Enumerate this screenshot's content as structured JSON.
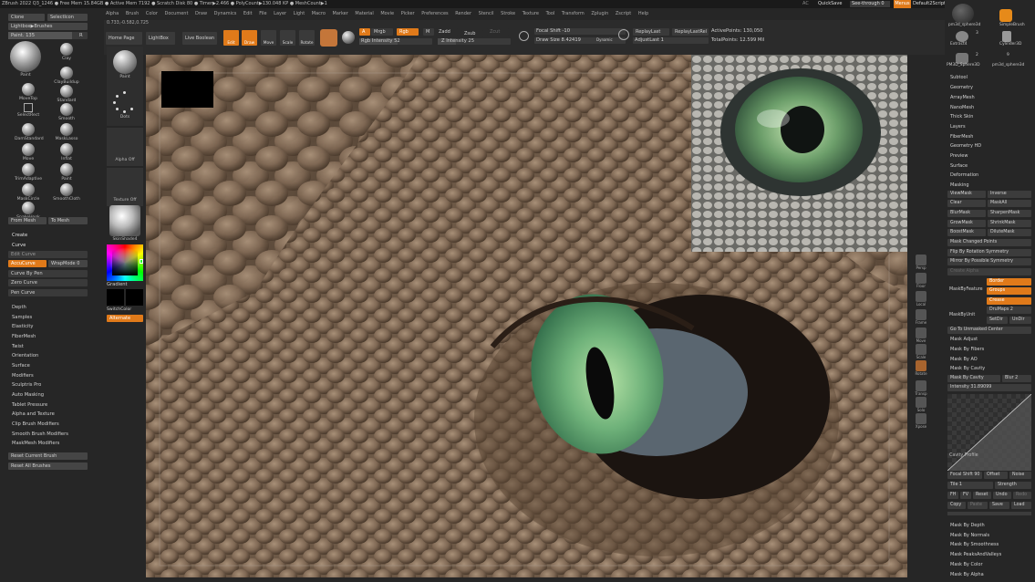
{
  "titlebar": {
    "text": "ZBrush 2022   Q3_1246   ● Free Mem 15.84GB ● Active Mem 7192 ● Scratch Disk 80 ● Timer▶2.466 ● PolyCount▶130.048 KP ● MeshCount▶1",
    "right_items": [
      "AC",
      "QuickSave",
      "See-through  0",
      "Menus",
      "Default2Script"
    ]
  },
  "menubar": {
    "items": [
      "Alpha",
      "Brush",
      "Color",
      "Document",
      "Draw",
      "Dynamics",
      "Edit",
      "File",
      "Layer",
      "Light",
      "Macro",
      "Marker",
      "Material",
      "Movie",
      "Picker",
      "Preferences",
      "Render",
      "Stencil",
      "Stroke",
      "Texture",
      "Tool",
      "Transform",
      "Zplugin",
      "Zscript",
      "Help"
    ]
  },
  "left": {
    "clone": "Clone",
    "select_icon": "SelectIcon",
    "lightbox_brushes": "Lightbox▶Brushes",
    "paint_value": "Paint. 135",
    "paint_suffix": "R",
    "brushes": [
      "Paint",
      "Clay",
      "ClayBuildup",
      "MoveTop",
      "Standard",
      "SelectRect",
      "Smooth",
      "DamStandard",
      "MaskLasso",
      "Move",
      "Inflat",
      "TrimAdaptive",
      "Paint",
      "MaskCircle",
      "SmoothCloth",
      "SnakeHook"
    ],
    "from_mesh": "From Mesh",
    "to_mesh": "To Mesh",
    "create": "Create",
    "curve": "Curve",
    "edit_curve": "Edit Curve",
    "accucurve": "AccuCurve",
    "wrapmode": "WrapMode 0",
    "curve_by_pen": "Curve By Pen",
    "zero_curve": "Zero Curve",
    "pen_curve": "Pen Curve",
    "sections": [
      "Depth",
      "Samples",
      "Elasticity",
      "FiberMesh",
      "Twist",
      "Orientation",
      "Surface",
      "Modifiers",
      "Sculptris Pro",
      "Auto Masking",
      "Tablet Pressure",
      "Alpha and Texture",
      "Clip Brush Modifiers",
      "Smooth Brush Modifiers",
      "MaskMesh Modifiers"
    ],
    "reset_current": "Reset Current Brush",
    "reset_all": "Reset All Brushes",
    "coords": "0.733,-0.582,0.725"
  },
  "toolbar": {
    "home_page": "Home Page",
    "lightbox": "LightBox",
    "live_boolean": "Live Boolean",
    "edit": "Edit",
    "draw": "Draw",
    "move": "Move",
    "scale": "Scale",
    "rotate": "Rotate",
    "a": "A",
    "mrgb": "Mrgb",
    "rgb": "Rgb",
    "m": "M",
    "zadd": "Zadd",
    "zsub": "Zsub",
    "zcut": "Zcut",
    "rgb_intensity": "Rgb Intensity 52",
    "z_intensity": "Z Intensity 25",
    "focal_shift": "Focal Shift -10",
    "draw_size": "Draw Size 8.42419",
    "dynamic": "Dynamic",
    "replay_last": "ReplayLast",
    "replay_last_rel": "ReplayLastRel",
    "adjust_last": "AdjustLast 1",
    "active_points": "ActivePoints: 130,050",
    "total_points": "TotalPoints: 12.599 Mil"
  },
  "shelf": {
    "brush_label": "Paint",
    "stroke_label": "Dots",
    "alpha_label": "Alpha Off",
    "texture_label": "Texture Off",
    "material_label": "SkinShade4",
    "gradient": "Gradient",
    "switch_color": "SwitchColor",
    "alternate": "Alternate"
  },
  "right": {
    "tools": [
      "pm3d_sphere3d",
      "SimpleBrush",
      "Extract4",
      "Cylinder3D",
      "PM3D_Sphere3D",
      "pm3d_sphere3d"
    ],
    "tool_counts": [
      "",
      "3",
      "2",
      "9"
    ],
    "subtool_items": [
      "Subtool",
      "Geometry",
      "ArrayMesh",
      "NanoMesh",
      "Thick Skin",
      "Layers",
      "FiberMesh",
      "Geometry HD",
      "Preview",
      "Surface",
      "Deformation",
      "Masking"
    ],
    "view_mask": "ViewMask",
    "inverse": "Inverse",
    "clear": "Clear",
    "mask_all": "MaskAll",
    "blur_mask": "BlurMask",
    "sharpen_mask": "SharpenMask",
    "grow_mask": "GrowMask",
    "shrink_mask": "ShrinkMask",
    "boost_mask": "BoostMask",
    "dilute_mask": "DiluteMask",
    "mask_changed": "Mask Changed Points",
    "flip_rotational": "Flip By Rotation Symmetry",
    "mirror_possible": "Mirror By Possible Symmetry",
    "create_alpha": "Create Alpha",
    "mask_by_feature": "MaskByFeature",
    "border": "Border",
    "groups": "Groups",
    "crease": "Crease",
    "mask_by_uv": "MaskByUnit",
    "drudmaps": "DruMaps 2",
    "setdir": "SetDir",
    "undir": "UnDir",
    "go_unmasked": "Go To Unmasked Center",
    "mask_adjust": "Mask Adjust",
    "mask_by_fibers": "Mask By Fibers",
    "mask_by_ao": "Mask By AO",
    "mask_by_cavity": "Mask By Cavity",
    "mask_by_cavity_btn": "Mask By Cavity",
    "blur": "Blur 2",
    "intensity": "Intensity 31.89099",
    "cavity_profile": "Cavity Profile",
    "focal_shift": "Focal Shift 90",
    "offset": "Offset",
    "noise": "Noise",
    "tile_1": "Tile 1",
    "strength": "Strength",
    "fh": "FH",
    "fv": "FV",
    "reset": "Reset",
    "undo": "Undo",
    "redo": "Redo",
    "copy": "Copy",
    "paste": "Paste",
    "save": "Save",
    "load": "Load",
    "bottom_items": [
      "Mask By Depth",
      "Mask By Normals",
      "Mask By Smoothness",
      "Mask PeaksAndValleys",
      "Mask By Color",
      "Mask By Alpha"
    ]
  },
  "rtools": [
    "Persp",
    "Floor",
    "Local",
    "Frame",
    "Move",
    "Scale",
    "Rotate",
    "Transp",
    "Solo",
    "Xpose"
  ]
}
